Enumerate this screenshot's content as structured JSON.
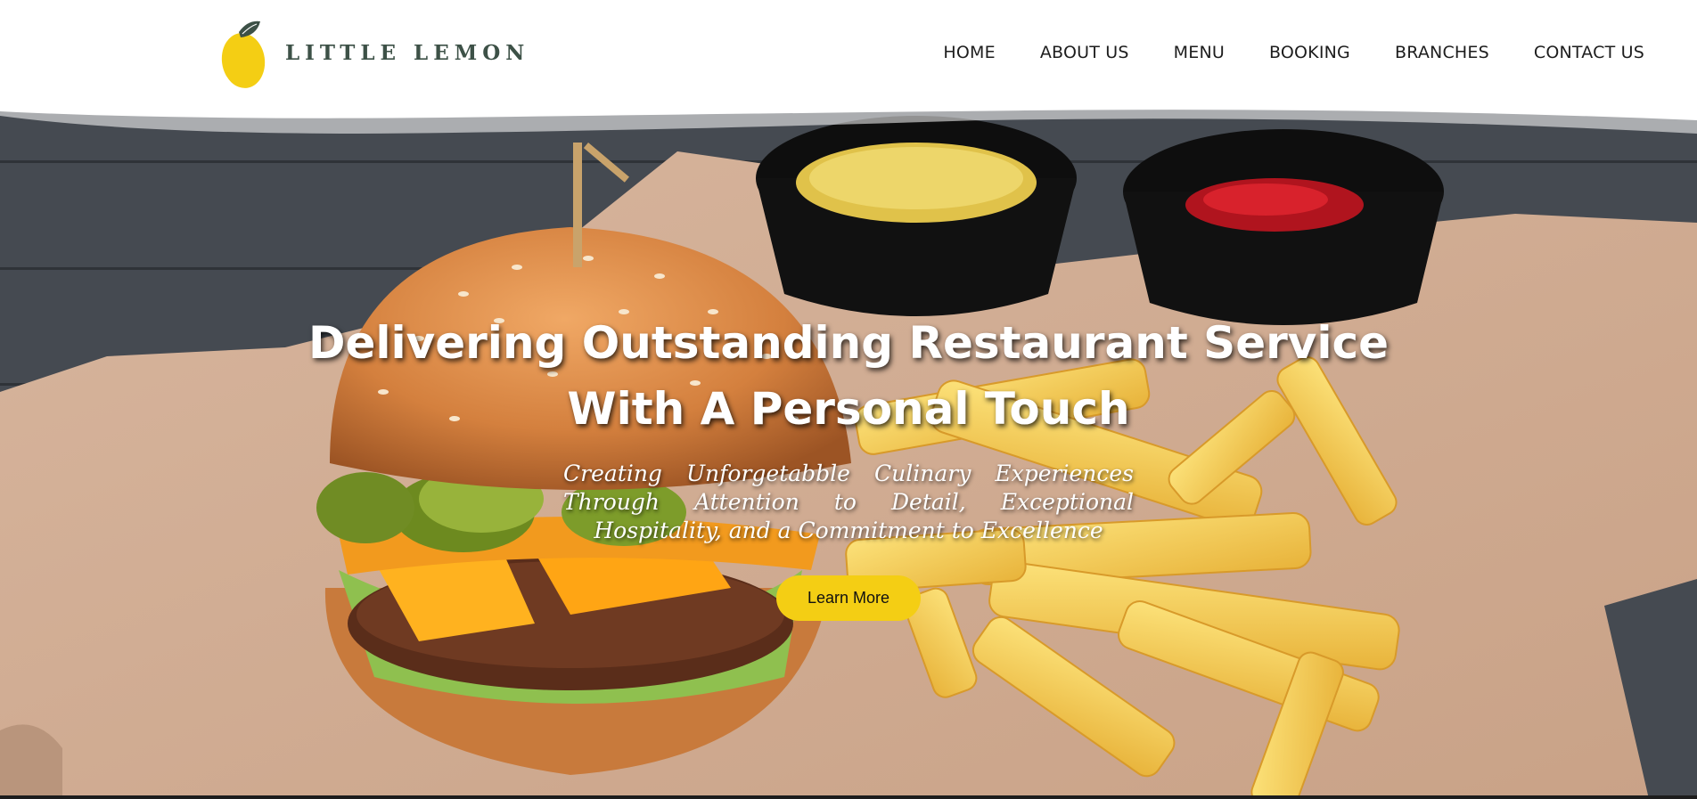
{
  "brand": {
    "name": "LITTLE LEMON",
    "logo_icon": "lemon-icon",
    "accent_color": "#f4ce14",
    "text_color": "#3d5147"
  },
  "nav": {
    "items": [
      {
        "label": "HOME"
      },
      {
        "label": "ABOUT US"
      },
      {
        "label": "MENU"
      },
      {
        "label": "BOOKING"
      },
      {
        "label": "BRANCHES"
      },
      {
        "label": "CONTACT US"
      }
    ]
  },
  "hero": {
    "headline_line1": "Delivering Outstanding Restaurant Service",
    "headline_line2": "With A Personal Touch",
    "subtitle": "Creating Unforgetabble Culinary Experiences Through Attention to Detail, Exceptional Hospitality, and a Commitment to Excellence",
    "cta_label": "Learn More",
    "background_icon": "burger-and-fries-photo"
  }
}
